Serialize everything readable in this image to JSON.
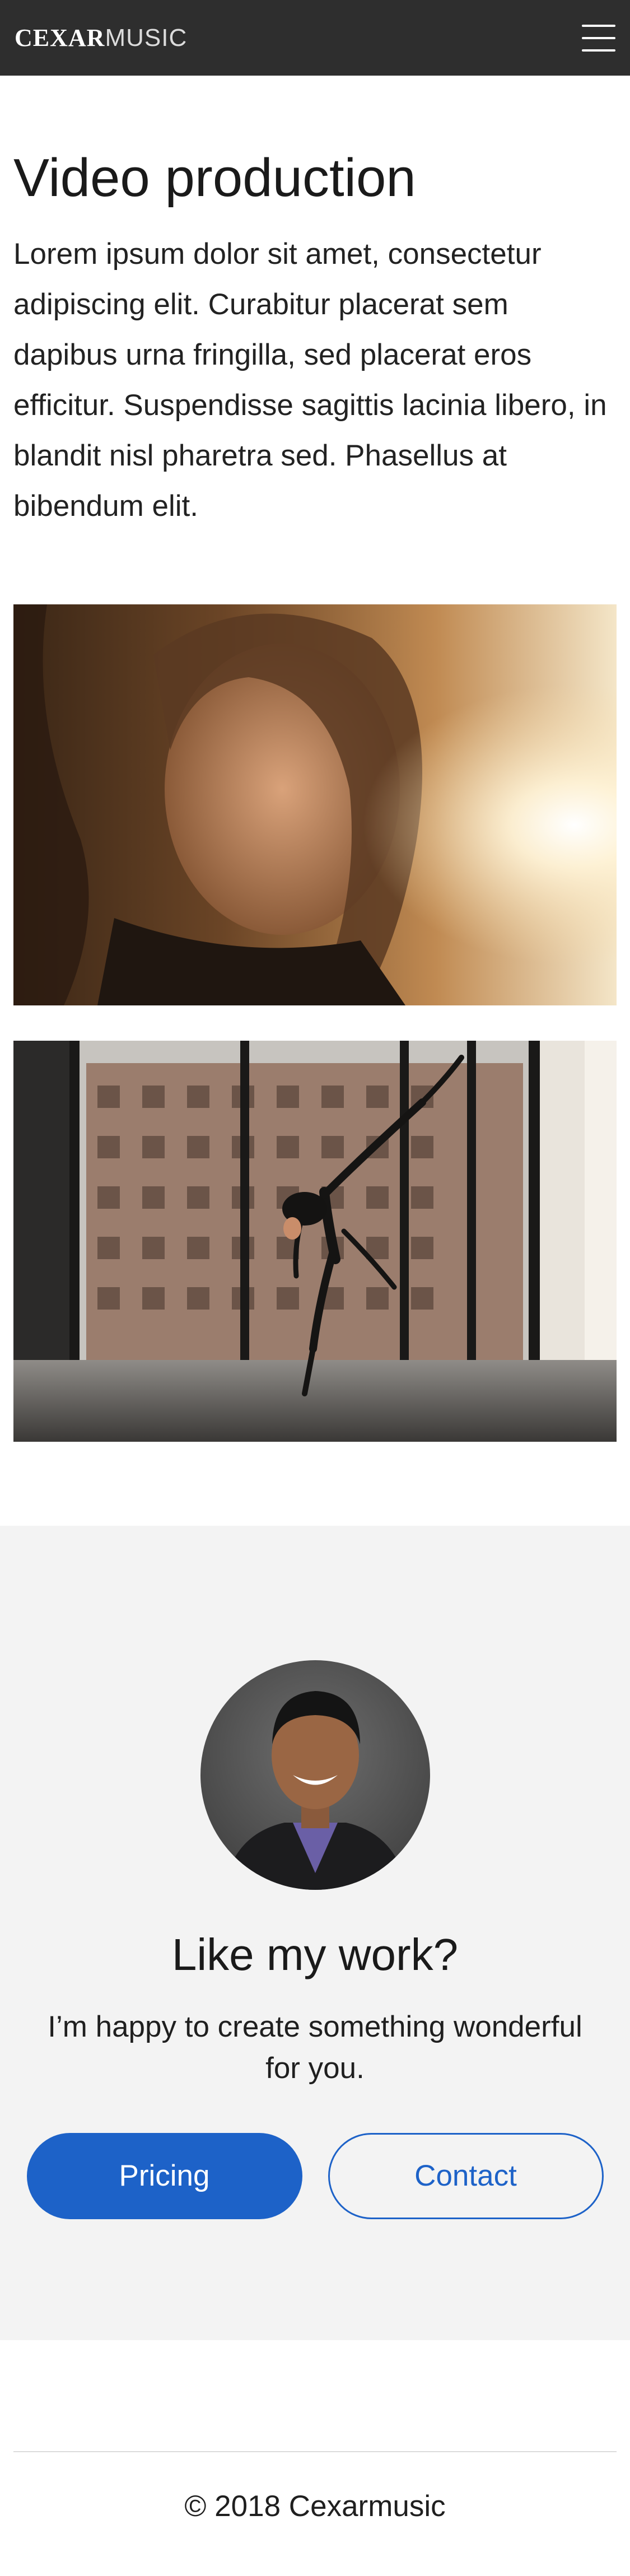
{
  "navbar": {
    "brand_bold": "CEXAR",
    "brand_light": "MUSIC"
  },
  "main": {
    "title": "Video production",
    "intro": "Lorem ipsum dolor sit amet, consectetur adipiscing elit. Curabitur placerat sem dapibus urna fringilla, sed placerat eros efficitur. Suspendisse sagittis lacinia libero, in blandit nisl pharetra sed. Phasellus at bibendum elit."
  },
  "cta": {
    "title": "Like my work?",
    "text": "I’m happy to create something wonderful for you.",
    "pricing_label": "Pricing",
    "contact_label": "Contact"
  },
  "footer": {
    "copyright": "© 2018 Cexarmusic"
  },
  "colors": {
    "navbar_bg": "#2e2e2e",
    "accent": "#1d62c8",
    "cta_bg": "#f3f3f3"
  },
  "icons": {
    "menu": "hamburger-menu-icon"
  }
}
